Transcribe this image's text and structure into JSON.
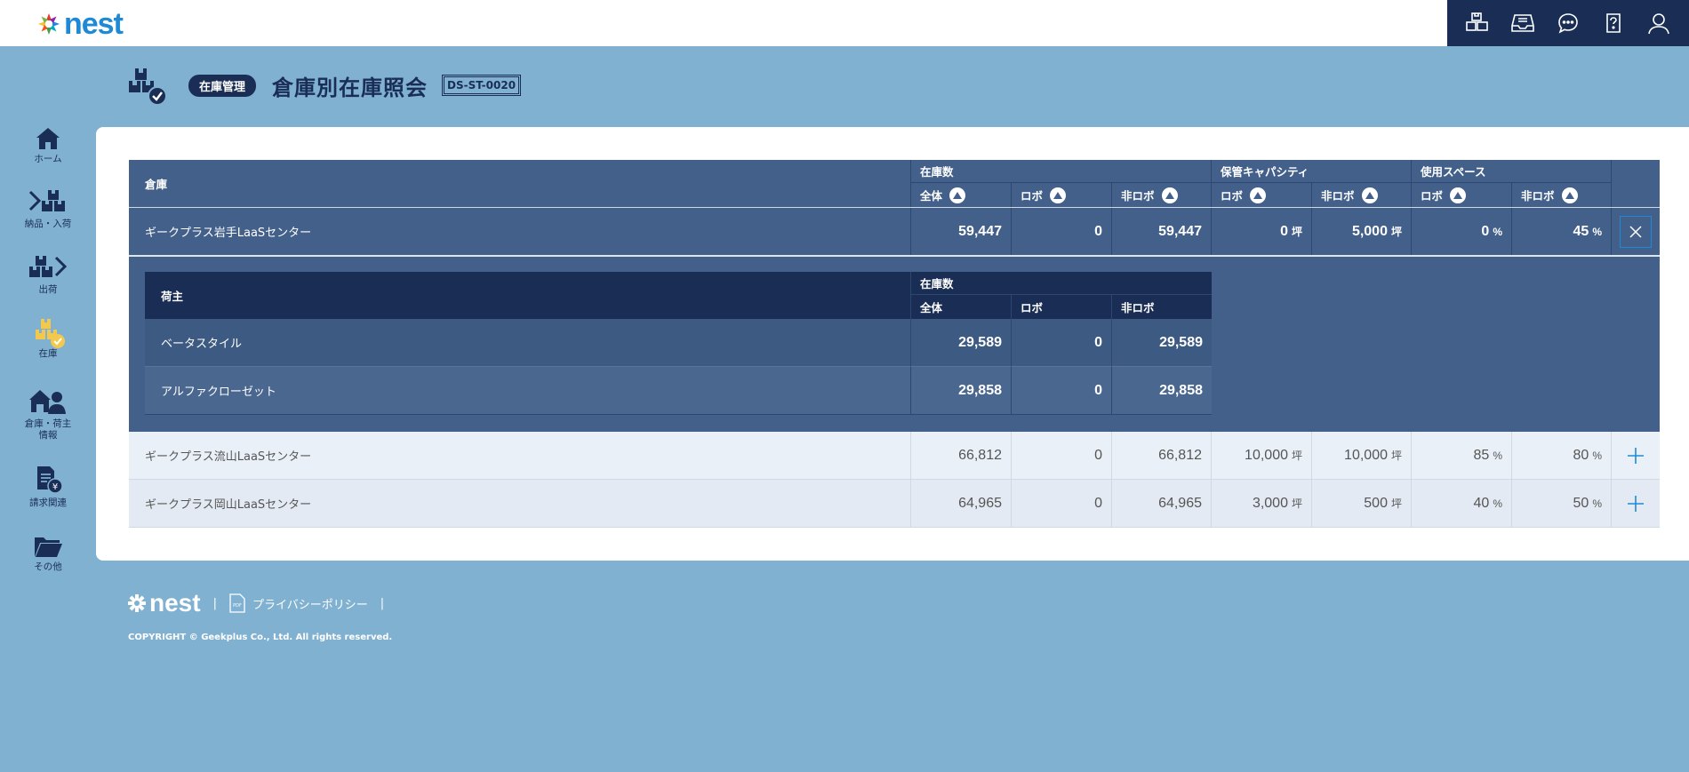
{
  "topbar": {
    "logo": "nest",
    "icons": [
      "boxes-icon",
      "inbox-icon",
      "chat-icon",
      "help-icon",
      "user-icon"
    ]
  },
  "sidebar": {
    "items": [
      {
        "label": "ホーム",
        "icon": "home-icon"
      },
      {
        "label": "納品・入荷",
        "icon": "inbound-icon"
      },
      {
        "label": "出荷",
        "icon": "outbound-icon"
      },
      {
        "label": "在庫",
        "icon": "inventory-icon",
        "active": true
      },
      {
        "label": "倉庫・荷主",
        "label2": "情報",
        "icon": "warehouse-owner-icon"
      },
      {
        "label": "請求関連",
        "icon": "billing-icon"
      },
      {
        "label": "その他",
        "icon": "folder-icon"
      }
    ]
  },
  "header": {
    "badge": "在庫管理",
    "title": "倉庫別在庫照会",
    "code": "DS-ST-0020"
  },
  "table": {
    "headers": {
      "warehouse": "倉庫",
      "stock": "在庫数",
      "capacity": "保管キャパシティ",
      "space": "使用スペース",
      "all": "全体",
      "robo": "ロボ",
      "nonrobo": "非ロボ"
    },
    "unit_tsubo": "坪",
    "unit_pct": "%",
    "rows": [
      {
        "name": "ギークプラス岩手LaaSセンター",
        "all": "59,447",
        "robo": "0",
        "nonrobo": "59,447",
        "cap_robo": "0",
        "cap_nonrobo": "5,000",
        "space_robo": "0",
        "space_nonrobo": "45",
        "expanded": true
      },
      {
        "name": "ギークプラス流山LaaSセンター",
        "all": "66,812",
        "robo": "0",
        "nonrobo": "66,812",
        "cap_robo": "10,000",
        "cap_nonrobo": "10,000",
        "space_robo": "85",
        "space_nonrobo": "80",
        "expanded": false
      },
      {
        "name": "ギークプラス岡山LaaSセンター",
        "all": "64,965",
        "robo": "0",
        "nonrobo": "64,965",
        "cap_robo": "3,000",
        "cap_nonrobo": "500",
        "space_robo": "40",
        "space_nonrobo": "50",
        "expanded": false
      }
    ],
    "sub": {
      "headers": {
        "owner": "荷主",
        "stock": "在庫数",
        "all": "全体",
        "robo": "ロボ",
        "nonrobo": "非ロボ"
      },
      "rows": [
        {
          "name": "ベータスタイル",
          "all": "29,589",
          "robo": "0",
          "nonrobo": "29,589"
        },
        {
          "name": "アルファクローゼット",
          "all": "29,858",
          "robo": "0",
          "nonrobo": "29,858"
        }
      ]
    }
  },
  "footer": {
    "logo": "nest",
    "privacy": "プライバシーポリシー",
    "copyright": "COPYRIGHT © Geekplus Co., Ltd. All rights reserved."
  },
  "colors": {
    "navy": "#1a2e55",
    "header_blue": "#43608a",
    "background": "#80b1d1",
    "accent": "#1e8ad6",
    "active_yellow": "#f2c94c"
  }
}
